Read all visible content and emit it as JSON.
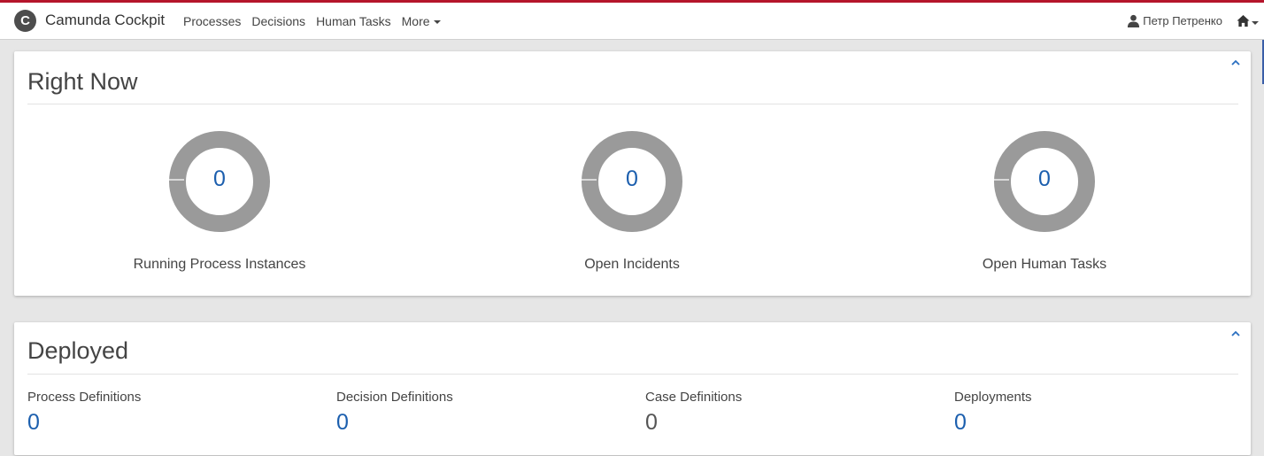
{
  "header": {
    "brand": "Camunda Cockpit",
    "logo_glyph": "C",
    "accent_color": "#b5152b",
    "nav": [
      {
        "label": "Processes"
      },
      {
        "label": "Decisions"
      },
      {
        "label": "Human Tasks"
      },
      {
        "label": "More"
      }
    ],
    "user_name": "Петр Петренко",
    "icons": [
      "user-icon",
      "home-icon",
      "chevron-down-icon"
    ]
  },
  "right_now": {
    "title": "Right Now",
    "metrics": [
      {
        "value": "0",
        "label": "Running Process Instances"
      },
      {
        "value": "0",
        "label": "Open Incidents"
      },
      {
        "value": "0",
        "label": "Open Human Tasks"
      }
    ],
    "donut_color": "#9a9a9a",
    "value_color": "#1c5fae"
  },
  "deployed": {
    "title": "Deployed",
    "stats": [
      {
        "label": "Process Definitions",
        "value": "0"
      },
      {
        "label": "Decision Definitions",
        "value": "0"
      },
      {
        "label": "Case Definitions",
        "value": "0"
      },
      {
        "label": "Deployments",
        "value": "0"
      }
    ]
  }
}
